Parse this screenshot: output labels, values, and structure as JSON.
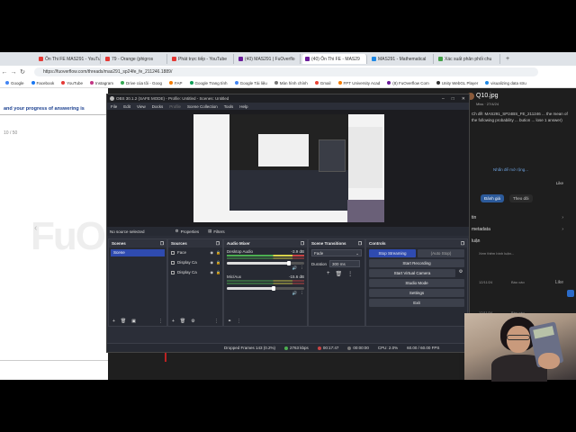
{
  "browser": {
    "tabs": [
      {
        "label": "Ôn Thi FE MAS291 - YouTu",
        "color": "#e53935"
      },
      {
        "label": "79 - Orange (phigros",
        "color": "#e53935"
      },
      {
        "label": "Phát trực tiếp - YouTube",
        "color": "#e53935"
      },
      {
        "label": "(40) MAS291 | FuOverflo",
        "color": "#6a1b9a"
      },
      {
        "label": "(40) Ôn Thi FE - MAS29",
        "color": "#6a1b9a"
      },
      {
        "label": "MAS291 - Mathematical",
        "color": "#1e88e5"
      },
      {
        "label": "Xác suất phân phối chu",
        "color": "#43a047"
      }
    ],
    "active_tab_index": 4,
    "url": "https://fuoverflow.com/threads/mas291_sp24fe_fe_211246.1889/",
    "bookmarks": [
      {
        "label": "Google",
        "color": "#4285f4"
      },
      {
        "label": "Facebook",
        "color": "#1877f2"
      },
      {
        "label": "YouTube",
        "color": "#e53935"
      },
      {
        "label": "Instagram",
        "color": "#c13584"
      },
      {
        "label": "Drive của tôi - Goog",
        "color": "#34a853"
      },
      {
        "label": "FAP",
        "color": "#f57c00"
      },
      {
        "label": "Google Trang tính",
        "color": "#0f9d58"
      },
      {
        "label": "Google Tài liệu",
        "color": "#4285f4"
      },
      {
        "label": "Màn hình chính",
        "color": "#777777"
      },
      {
        "label": "Gmail",
        "color": "#ea4335"
      },
      {
        "label": "FPT University Acad",
        "color": "#f57c00"
      },
      {
        "label": "(8) FuOverflow Com",
        "color": "#6a1b9a"
      },
      {
        "label": "Unity WebGL Player",
        "color": "#333333"
      },
      {
        "label": "visualizing data stru",
        "color": "#1e88e5"
      }
    ]
  },
  "left_page": {
    "progress_text": "and your progress of answering is",
    "page_count": "10 / 50",
    "watermark": "FuO"
  },
  "right_page": {
    "title": "Q10.jpg",
    "meta": "Miss · 27/4/24",
    "description": "Ch đề: MAS291_SP24BS_FE_211246 ... the mean of the following probability ... bution ... lose 1 answer)",
    "see_more": "Nhấn để mở rộng...",
    "actions": [
      "Đánh giá",
      "Theo dõi"
    ],
    "like": "Like",
    "sections": [
      "tin",
      "metadata",
      "luận"
    ],
    "comment_meta": "12/11/24",
    "reply": "Báo cáo",
    "show_more": "Xem thêm bình luận..."
  },
  "obs": {
    "title": "OBS 30.1.2 (SAFE MODE) - Profile: Untitled - Scenes: Untitled",
    "menu": [
      "File",
      "Edit",
      "View",
      "Docks",
      "Profile",
      "Scene Collection",
      "Tools",
      "Help"
    ],
    "no_source": "No source selected",
    "properties": "Properties",
    "filters": "Filters",
    "docks": {
      "scenes": {
        "title": "Scenes",
        "items": [
          "Scene"
        ]
      },
      "sources": {
        "title": "Sources",
        "items": [
          "Face",
          "Display Ca",
          "Display Ca"
        ]
      },
      "mixer": {
        "title": "Audio Mixer",
        "channels": [
          {
            "name": "Desktop Audio",
            "db": "-3.9 dB",
            "level": 0.62,
            "volume": 0.8
          },
          {
            "name": "Mic/Aux",
            "db": "-15.6 dB",
            "level": 0.0,
            "volume": 0.6
          }
        ]
      },
      "transitions": {
        "title": "Scene Transitions",
        "type": "Fade",
        "duration_label": "Duration",
        "duration": "300 ms"
      },
      "controls": {
        "title": "Controls",
        "stream": "Stop Streaming",
        "auto_stop": "(Auto Stop)",
        "record": "Start Recording",
        "virtual_cam": "Start Virtual Camera",
        "studio": "Studio Mode",
        "settings": "Settings",
        "exit": "Exit"
      }
    },
    "status": {
      "dropped": "Dropped Frames 143 (0.2%)",
      "kbps": "2763 kbps",
      "live_time": "00:17:47",
      "rec_time": "00:00:00",
      "cpu": "CPU: 2.0%",
      "fps": "60.00 / 60.00 FPS"
    }
  }
}
